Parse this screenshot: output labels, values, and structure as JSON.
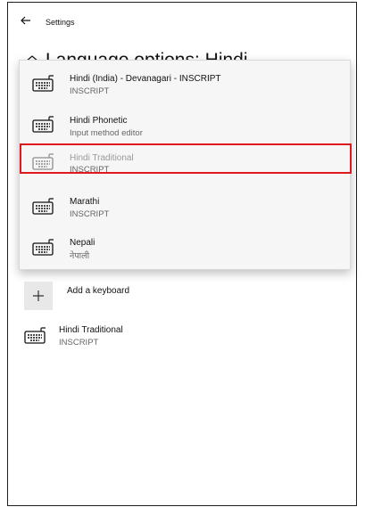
{
  "window": {
    "title": "Settings"
  },
  "page": {
    "heading": "Language options: Hindi"
  },
  "dropdown": {
    "items": [
      {
        "title": "Hindi (India) - Devanagari - INSCRIPT",
        "subtitle": "INSCRIPT",
        "disabled": false
      },
      {
        "title": "Hindi Phonetic",
        "subtitle": "Input method editor",
        "disabled": false
      },
      {
        "title": "Hindi Traditional",
        "subtitle": "INSCRIPT",
        "disabled": true
      },
      {
        "title": "Marathi",
        "subtitle": "INSCRIPT",
        "disabled": false
      },
      {
        "title": "Nepali",
        "subtitle": "नेपाली",
        "disabled": false
      }
    ]
  },
  "add_keyboard": {
    "label": "Add a keyboard"
  },
  "installed_keyboards": [
    {
      "title": "Hindi Traditional",
      "subtitle": "INSCRIPT"
    }
  ],
  "colors": {
    "highlight_border": "#e0191e",
    "dropdown_bg": "#f6f6f6"
  },
  "icons": {
    "back": "back-arrow-icon",
    "home": "home-icon",
    "keyboard": "keyboard-icon",
    "add": "plus-icon"
  }
}
